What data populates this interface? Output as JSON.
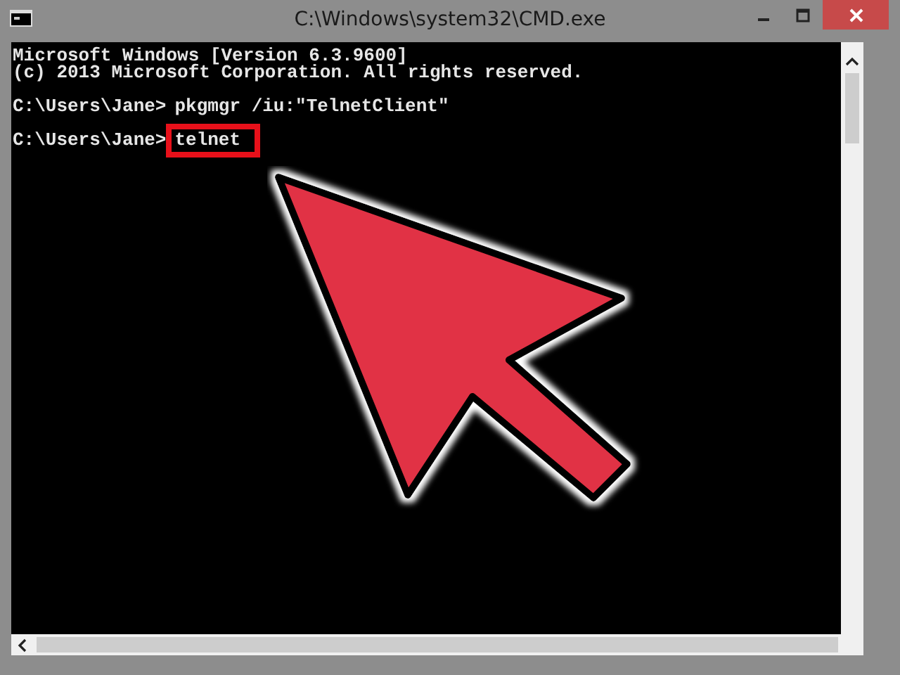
{
  "window": {
    "title": "C:\\Windows\\system32\\CMD.exe"
  },
  "console": {
    "lines": [
      {
        "kind": "output",
        "text": "Microsoft Windows [Version 6.3.9600]"
      },
      {
        "kind": "output",
        "text": "(c) 2013 Microsoft Corporation. All rights reserved."
      },
      {
        "kind": "blank"
      },
      {
        "kind": "prompt",
        "prompt": "C:\\Users\\Jane>",
        "command": "pkgmgr /iu:\"TelnetClient\"",
        "highlighted": false
      },
      {
        "kind": "blank"
      },
      {
        "kind": "prompt",
        "prompt": "C:\\Users\\Jane>",
        "command": "telnet",
        "highlighted": true
      }
    ]
  }
}
